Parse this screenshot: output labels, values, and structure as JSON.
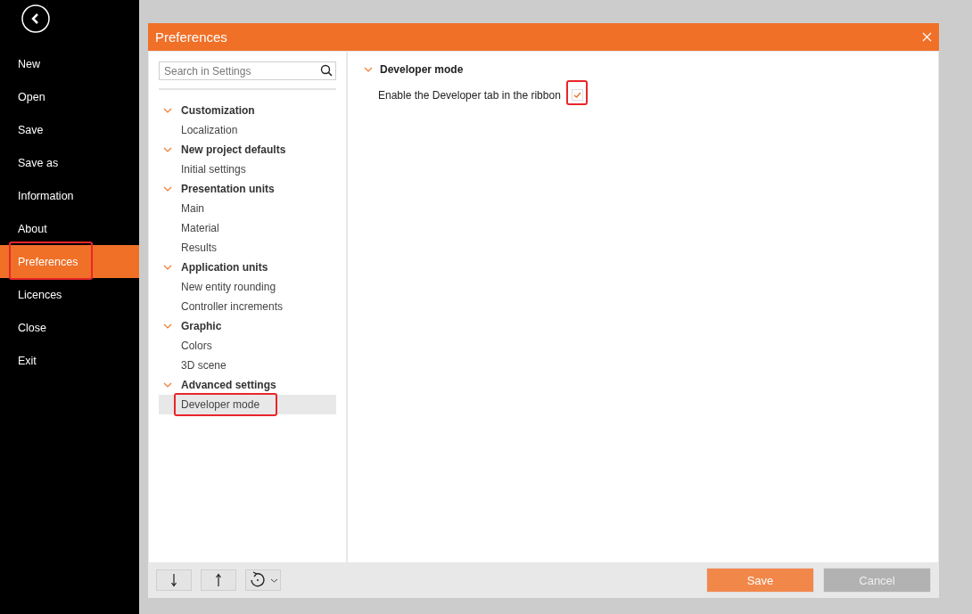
{
  "sidebar": {
    "items": [
      {
        "label": "New",
        "selected": false,
        "highlighted": false
      },
      {
        "label": "Open",
        "selected": false,
        "highlighted": false
      },
      {
        "label": "Save",
        "selected": false,
        "highlighted": false
      },
      {
        "label": "Save as",
        "selected": false,
        "highlighted": false
      },
      {
        "label": "Information",
        "selected": false,
        "highlighted": false
      },
      {
        "label": "About",
        "selected": false,
        "highlighted": false
      },
      {
        "label": "Preferences",
        "selected": true,
        "highlighted": true
      },
      {
        "label": "Licences",
        "selected": false,
        "highlighted": false
      },
      {
        "label": "Close",
        "selected": false,
        "highlighted": false
      },
      {
        "label": "Exit",
        "selected": false,
        "highlighted": false
      }
    ]
  },
  "dialog": {
    "title": "Preferences",
    "search": {
      "placeholder": "Search in Settings"
    },
    "tree": [
      {
        "label": "Customization",
        "expanded": true,
        "children": [
          {
            "label": "Localization",
            "selected": false,
            "highlighted": false
          }
        ]
      },
      {
        "label": "New project defaults",
        "expanded": true,
        "children": [
          {
            "label": "Initial settings",
            "selected": false,
            "highlighted": false
          }
        ]
      },
      {
        "label": "Presentation units",
        "expanded": true,
        "children": [
          {
            "label": "Main",
            "selected": false,
            "highlighted": false
          },
          {
            "label": "Material",
            "selected": false,
            "highlighted": false
          },
          {
            "label": "Results",
            "selected": false,
            "highlighted": false
          }
        ]
      },
      {
        "label": "Application units",
        "expanded": true,
        "children": [
          {
            "label": "New entity rounding",
            "selected": false,
            "highlighted": false
          },
          {
            "label": "Controller increments",
            "selected": false,
            "highlighted": false
          }
        ]
      },
      {
        "label": "Graphic",
        "expanded": true,
        "children": [
          {
            "label": "Colors",
            "selected": false,
            "highlighted": false
          },
          {
            "label": "3D scene",
            "selected": false,
            "highlighted": false
          }
        ]
      },
      {
        "label": "Advanced settings",
        "expanded": true,
        "children": [
          {
            "label": "Developer mode",
            "selected": true,
            "highlighted": true
          }
        ]
      }
    ],
    "section": {
      "title": "Developer mode",
      "expanded": true,
      "options": [
        {
          "label": "Enable the Developer tab in the ribbon",
          "checked": true,
          "highlighted": true
        }
      ]
    },
    "buttons": [
      {
        "label": "Save",
        "kind": "primary"
      },
      {
        "label": "Cancel",
        "kind": "secondary"
      }
    ]
  }
}
